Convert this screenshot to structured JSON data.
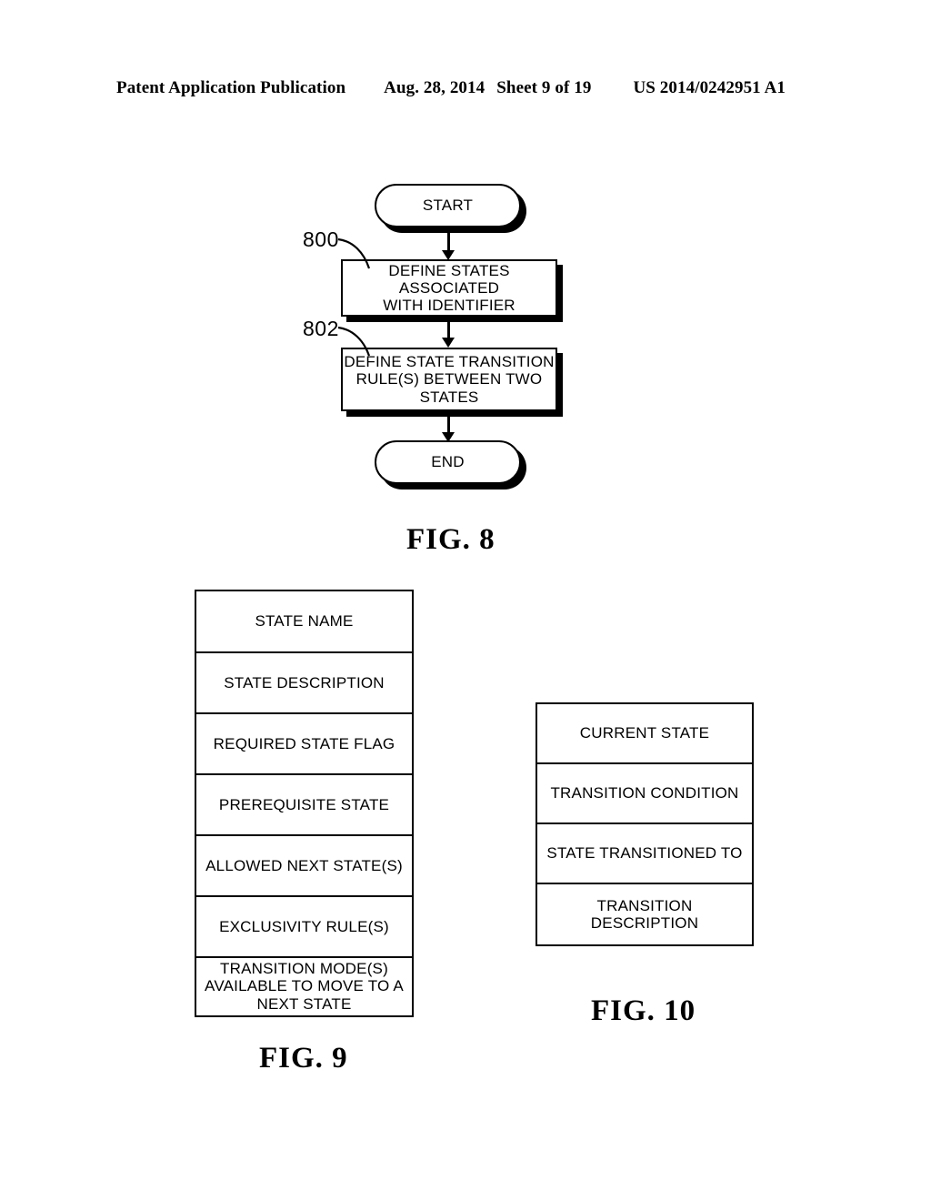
{
  "header": {
    "publication": "Patent Application Publication",
    "date": "Aug. 28, 2014",
    "sheet": "Sheet 9 of 19",
    "patent_number": "US 2014/0242951 A1"
  },
  "figures": [
    {
      "id": "fig8",
      "caption": "FIG. 8",
      "type": "flowchart",
      "nodes": [
        {
          "id": "start",
          "shape": "terminator",
          "label": "START"
        },
        {
          "id": "step800",
          "shape": "process",
          "label": "DEFINE STATES ASSOCIATED WITH IDENTIFIER",
          "ref": "800"
        },
        {
          "id": "step802",
          "shape": "process",
          "label": "DEFINE STATE TRANSITION RULE(S) BETWEEN TWO STATES",
          "ref": "802"
        },
        {
          "id": "end",
          "shape": "terminator",
          "label": "END"
        }
      ],
      "reference_numerals": [
        "800",
        "802"
      ]
    },
    {
      "id": "fig9",
      "caption": "FIG. 9",
      "type": "field-table",
      "rows": [
        "STATE NAME",
        "STATE DESCRIPTION",
        "REQUIRED STATE FLAG",
        "PREREQUISITE STATE",
        "ALLOWED NEXT STATE(S)",
        "EXCLUSIVITY RULE(S)",
        "TRANSITION MODE(S) AVAILABLE TO MOVE TO A NEXT STATE"
      ]
    },
    {
      "id": "fig10",
      "caption": "FIG. 10",
      "type": "field-table",
      "rows": [
        "CURRENT STATE",
        "TRANSITION CONDITION",
        "STATE TRANSITIONED TO",
        "TRANSITION DESCRIPTION"
      ]
    }
  ],
  "fig8_labels": {
    "start": "START",
    "step800": "DEFINE STATES ASSOCIATED WITH IDENTIFIER",
    "step800_line1": "DEFINE STATES ASSOCIATED",
    "step800_line2": "WITH IDENTIFIER",
    "step802_line1": "DEFINE STATE TRANSITION",
    "step802_line2": "RULE(S) BETWEEN TWO",
    "step802_line3": "STATES",
    "end": "END",
    "ref800": "800",
    "ref802": "802",
    "caption": "FIG. 8"
  },
  "fig9_labels": {
    "row0": "STATE NAME",
    "row1": "STATE DESCRIPTION",
    "row2": "REQUIRED STATE FLAG",
    "row3": "PREREQUISITE STATE",
    "row4": "ALLOWED NEXT STATE(S)",
    "row5": "EXCLUSIVITY RULE(S)",
    "row6_line1": "TRANSITION MODE(S)",
    "row6_line2": "AVAILABLE TO MOVE TO A",
    "row6_line3": "NEXT STATE",
    "caption": "FIG. 9"
  },
  "fig10_labels": {
    "row0": "CURRENT STATE",
    "row1": "TRANSITION CONDITION",
    "row2": "STATE TRANSITIONED TO",
    "row3": "TRANSITION DESCRIPTION",
    "caption": "FIG. 10"
  },
  "colors": {
    "ink": "#000000",
    "paper": "#ffffff"
  }
}
